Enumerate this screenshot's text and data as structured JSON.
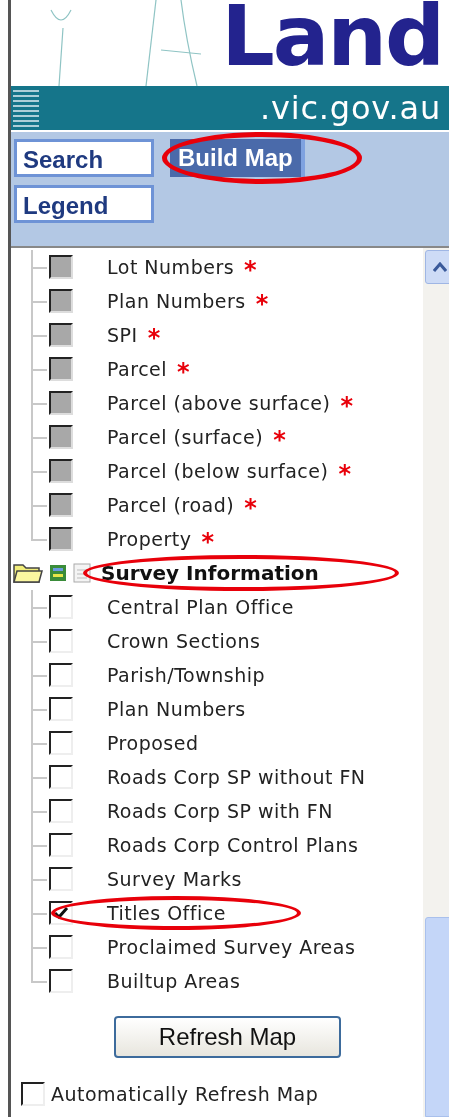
{
  "header": {
    "logo": "Land",
    "domain": ".vic.gov.au"
  },
  "tabs": [
    {
      "label": "Search",
      "selected": false,
      "highlighted": false
    },
    {
      "label": "Build Map",
      "selected": true,
      "highlighted": true
    },
    {
      "label": "Legend",
      "selected": false,
      "highlighted": false
    }
  ],
  "layers": [
    {
      "label": "Lot Numbers",
      "star": "*",
      "checked": false,
      "disabled": true
    },
    {
      "label": "Plan Numbers",
      "star": "*",
      "checked": false,
      "disabled": true
    },
    {
      "label": "SPI",
      "star": "*",
      "checked": false,
      "disabled": true
    },
    {
      "label": "Parcel",
      "star": "*",
      "checked": false,
      "disabled": true
    },
    {
      "label": "Parcel (above surface)",
      "star": "*",
      "checked": false,
      "disabled": true
    },
    {
      "label": "Parcel (surface)",
      "star": "*",
      "checked": false,
      "disabled": true
    },
    {
      "label": "Parcel (below surface)",
      "star": "*",
      "checked": false,
      "disabled": true
    },
    {
      "label": "Parcel (road)",
      "star": "*",
      "checked": false,
      "disabled": true
    },
    {
      "label": "Property",
      "star": "*",
      "checked": false,
      "disabled": true
    }
  ],
  "group": {
    "label": "Survey Information",
    "highlighted": true,
    "children": [
      {
        "label": "Central Plan Office",
        "checked": false,
        "highlighted": false
      },
      {
        "label": "Crown Sections",
        "checked": false,
        "highlighted": false
      },
      {
        "label": "Parish/Township",
        "checked": false,
        "highlighted": false
      },
      {
        "label": "Plan Numbers",
        "checked": false,
        "highlighted": false
      },
      {
        "label": "Proposed",
        "checked": false,
        "highlighted": false
      },
      {
        "label": "Roads Corp SP without FN",
        "checked": false,
        "highlighted": false
      },
      {
        "label": "Roads Corp SP with FN",
        "checked": false,
        "highlighted": false
      },
      {
        "label": "Roads Corp Control Plans",
        "checked": false,
        "highlighted": false
      },
      {
        "label": "Survey Marks",
        "checked": false,
        "highlighted": false
      },
      {
        "label": "Titles Office",
        "checked": true,
        "highlighted": true
      },
      {
        "label": "Proclaimed Survey Areas",
        "checked": false,
        "highlighted": false
      },
      {
        "label": "Builtup Areas",
        "checked": false,
        "highlighted": false
      }
    ]
  },
  "refresh_button": "Refresh Map",
  "auto_refresh": {
    "label": "Automatically Refresh Map",
    "checked": false
  }
}
